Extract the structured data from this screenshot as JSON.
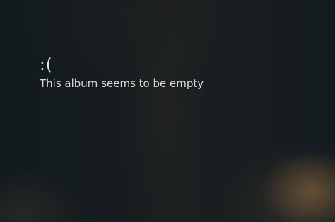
{
  "empty_state": {
    "emoticon": ":(",
    "message": "This album seems to be empty"
  },
  "colors": {
    "background": "#151c20",
    "text": "#d8d8d8",
    "glow": "#966e46"
  }
}
